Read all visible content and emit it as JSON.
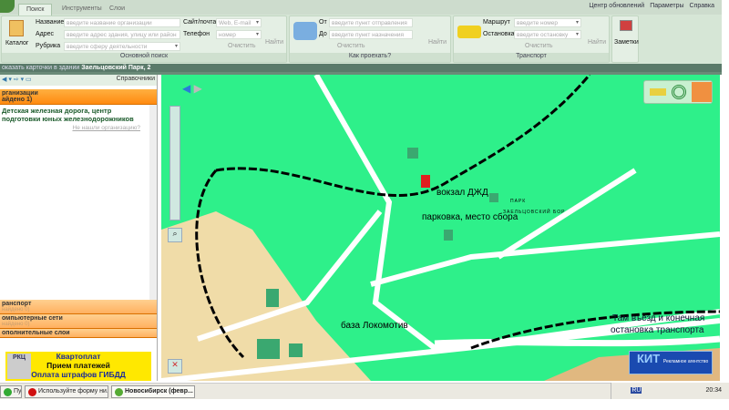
{
  "ribbon": {
    "tabs": [
      "Поиск",
      "Инструменты",
      "Слои"
    ],
    "top_links": [
      "Центр обновлений",
      "Параметры",
      "Справка"
    ],
    "main_search": {
      "catalog": "Каталог",
      "name_label": "Название",
      "name_placeholder": "введите название организации",
      "address_label": "Адрес",
      "address_placeholder": "введите адрес здания, улицу или район",
      "rubric_label": "Рубрика",
      "rubric_placeholder": "введите сферу деятельности",
      "site_label": "Сайт/почта",
      "site_placeholder": "Web, E-mail",
      "phone_label": "Телефон",
      "phone_placeholder": "номер",
      "clear": "Очистить",
      "find": "Найти",
      "title": "Основной поиск"
    },
    "route": {
      "from_label": "От",
      "from_placeholder": "введите пункт отправления",
      "to_label": "До",
      "to_placeholder": "введите пункт назначения",
      "clear": "Очистить",
      "find": "Найти",
      "title": "Как проехать?"
    },
    "transport": {
      "route_label": "Маршрут",
      "route_placeholder": "введите номер",
      "stop_label": "Остановка",
      "stop_placeholder": "введите остановку",
      "clear": "Очистить",
      "find": "Найти",
      "title": "Транспорт"
    },
    "notes": "Заметки"
  },
  "status": {
    "prefix": "оказать карточки в здании",
    "building": "Заельцовский Парк, 2"
  },
  "left": {
    "directories": "Справочники",
    "org_header": "рганизации",
    "org_count": "айдено 1)",
    "result": "Детская железная дорога, центр подготовки юных железнодорожников",
    "not_found": "Не нашли организацию?",
    "sections": [
      {
        "label": "ранспорт",
        "sub": "найдено 0)"
      },
      {
        "label": "омпьютерные сети",
        "sub": "найдено 0)"
      },
      {
        "label": "ополнительные слои",
        "sub": ""
      }
    ],
    "ad": {
      "logo": "РКЦ",
      "line1": "Квартоплат",
      "line2": "Прием платежей",
      "line3": "Оплата штрафов ГИБДД"
    }
  },
  "map": {
    "labels": {
      "station": "вокзал ДЖД",
      "parking": "парковка, место сбора",
      "base": "база Локомотив",
      "entrance1": "Там въезд и конечная",
      "entrance2": "остановка транспорта",
      "park1": "ПАРК",
      "park2": "ЗАЕЛЬЦОВСКИЙ БОР"
    },
    "ad_logo": "КИТ",
    "ad_text": "Рекламное агентство"
  },
  "taskbar": {
    "start": "Пуск",
    "items": [
      "Используйте форму ни...",
      "Новосибирск (февр..."
    ],
    "lang": "RU",
    "time": "20:34"
  }
}
